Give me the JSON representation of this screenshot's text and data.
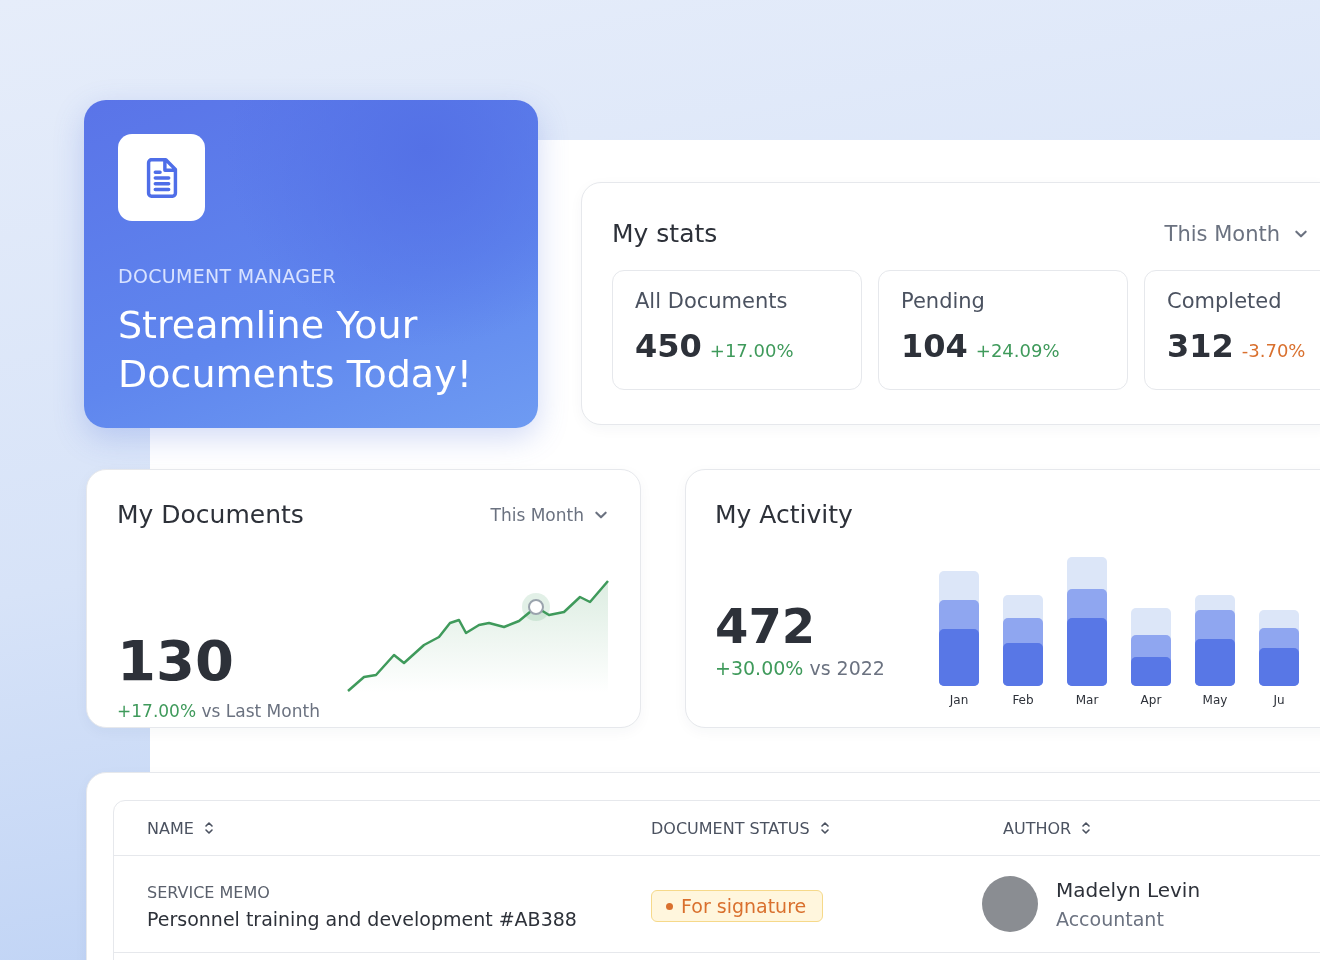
{
  "hero": {
    "eyebrow": "DOCUMENT MANAGER",
    "heading": "Streamline Your Documents Today!"
  },
  "stats": {
    "title": "My stats",
    "period": "This Month",
    "cards": [
      {
        "label": "All Documents",
        "value": "450",
        "change": "+17.00%",
        "kind": "up"
      },
      {
        "label": "Pending",
        "value": "104",
        "change": "+24.09%",
        "kind": "up"
      },
      {
        "label": "Completed",
        "value": "312",
        "change": "-3.70%",
        "kind": "down"
      }
    ]
  },
  "documents": {
    "title": "My Documents",
    "period": "This Month",
    "value": "130",
    "change": "+17.00%",
    "comparison": "vs Last Month"
  },
  "activity": {
    "title": "My Activity",
    "value": "472",
    "change": "+30.00%",
    "comparison": "vs 2022",
    "months": [
      "Jan",
      "Feb",
      "Mar",
      "Apr",
      "May",
      "Ju"
    ]
  },
  "table": {
    "columns": [
      "NAME",
      "DOCUMENT STATUS",
      "AUTHOR"
    ],
    "rows": [
      {
        "category": "SERVICE MEMO",
        "name": "Personnel training and development #AB388",
        "status": {
          "label": "For signature",
          "kind": "pending"
        },
        "author": {
          "name": "Madelyn Levin",
          "role": "Accountant"
        }
      }
    ]
  }
}
